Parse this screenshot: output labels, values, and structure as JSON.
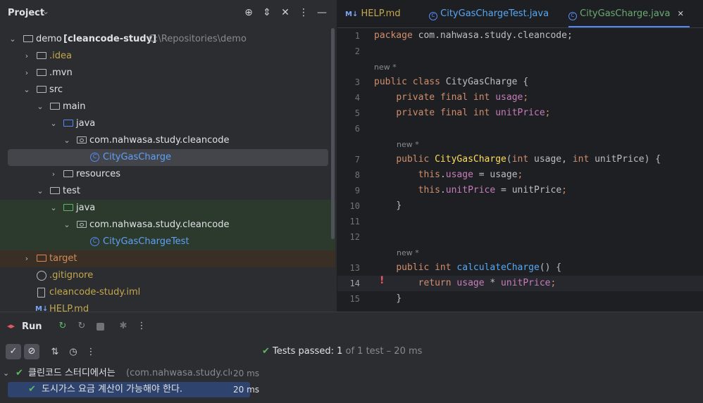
{
  "project": {
    "title": "Project",
    "tree": [
      {
        "name": "demo",
        "suffix": "[cleancode-study]",
        "path": "C:\\Repositories\\demo"
      },
      {
        "name": ".idea"
      },
      {
        "name": ".mvn"
      },
      {
        "name": "src"
      },
      {
        "name": "main"
      },
      {
        "name": "java"
      },
      {
        "name": "com.nahwasa.study.cleancode"
      },
      {
        "name": "CityGasCharge"
      },
      {
        "name": "resources"
      },
      {
        "name": "test"
      },
      {
        "name": "java"
      },
      {
        "name": "com.nahwasa.study.cleancode"
      },
      {
        "name": "CityGasChargeTest"
      },
      {
        "name": "target"
      },
      {
        "name": ".gitignore"
      },
      {
        "name": "cleancode-study.iml"
      },
      {
        "name": "HELP.md",
        "badge": "M↓"
      }
    ]
  },
  "editor": {
    "tabs": [
      {
        "badge": "M↓",
        "label": "HELP.md"
      },
      {
        "label": "CityGasChargeTest.java"
      },
      {
        "label": "CityGasCharge.java",
        "close": "✕"
      }
    ],
    "hint": "new *",
    "lines": {
      "l1": "1",
      "l2": "2",
      "l3": "3",
      "l4": "4",
      "l5": "5",
      "l6": "6",
      "l7": "7",
      "l8": "8",
      "l9": "9",
      "l10": "10",
      "l11": "11",
      "l12": "12",
      "l13": "13",
      "l14": "14",
      "l15": "15"
    },
    "code": {
      "package_kw": "package",
      "package_name": " com.nahwasa.study.cleancode;",
      "public": "public",
      "class": "class",
      "class_name": "CityGasCharge",
      "brace_open": " {",
      "private": "private",
      "final": "final",
      "int": "int",
      "usage": "usage",
      "unitPrice": "unitPrice",
      "semi": ";",
      "ctor_name": "CityGasCharge",
      "this": "this",
      "calc_name": "calculateCharge",
      "return": "return",
      "brace_close": "}"
    }
  },
  "run": {
    "label": "Run",
    "status_prefix": "Tests passed:",
    "status_count": "1",
    "status_suffix": "of 1 test – 20 ms",
    "results": [
      {
        "label": "클린코드 스터디에서는",
        "detail": "(com.nahwasa.study.cle",
        "time": "20 ms"
      },
      {
        "label": "도시가스 요금 계산이 가능해야 한다.",
        "time": "20 ms"
      }
    ]
  },
  "colors": {
    "accent": "#548af7",
    "pass": "#5fb865",
    "error": "#e55765"
  }
}
